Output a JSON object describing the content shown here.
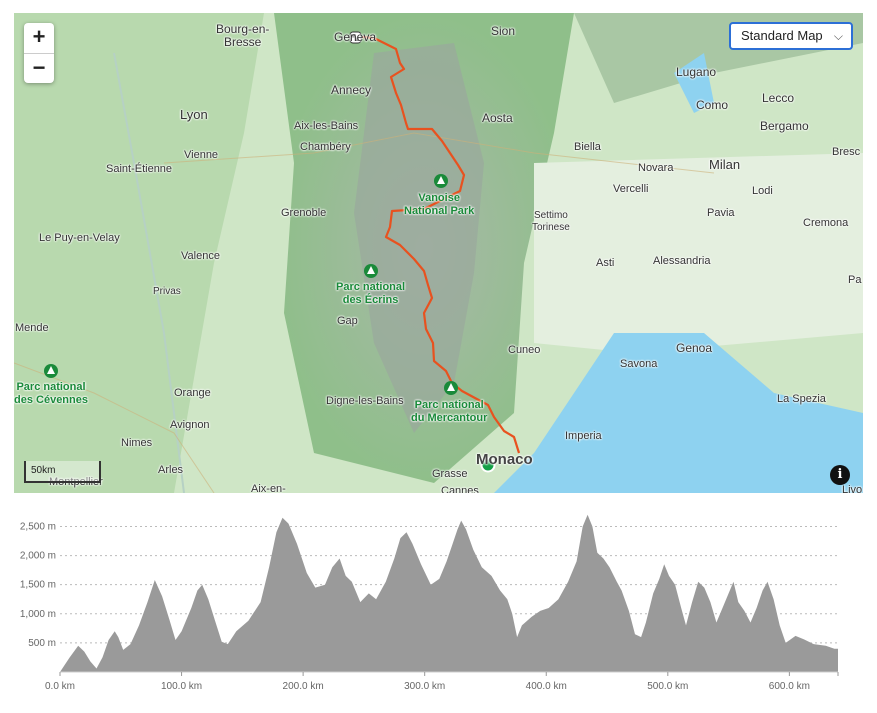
{
  "map": {
    "zoom_in": "+",
    "zoom_out": "−",
    "map_type": "Standard Map",
    "scale_label": "50km",
    "info_label": "i",
    "cities": [
      {
        "name": "Bourg-en-\nBresse"
      },
      {
        "name": "Geneva"
      },
      {
        "name": "Sion"
      },
      {
        "name": "Lugano"
      },
      {
        "name": "Annecy"
      },
      {
        "name": "Como"
      },
      {
        "name": "Lecco"
      },
      {
        "name": "Lyon"
      },
      {
        "name": "Aosta"
      },
      {
        "name": "Bergamo"
      },
      {
        "name": "Aix-les-Bains"
      },
      {
        "name": "Vienne"
      },
      {
        "name": "Chambéry"
      },
      {
        "name": "Biella"
      },
      {
        "name": "Milan"
      },
      {
        "name": "Bresc"
      },
      {
        "name": "Saint-Étienne"
      },
      {
        "name": "Novara"
      },
      {
        "name": "Vercelli"
      },
      {
        "name": "Lodi"
      },
      {
        "name": "Grenoble"
      },
      {
        "name": "Pavia"
      },
      {
        "name": "Settimo\nTorinese"
      },
      {
        "name": "Cremona"
      },
      {
        "name": "Le Puy-en-Velay"
      },
      {
        "name": "Valence"
      },
      {
        "name": "Asti"
      },
      {
        "name": "Alessandria"
      },
      {
        "name": "Privas"
      },
      {
        "name": "Pa"
      },
      {
        "name": "Gap"
      },
      {
        "name": "Mende"
      },
      {
        "name": "Cuneo"
      },
      {
        "name": "Genoa"
      },
      {
        "name": "Savona"
      },
      {
        "name": "Orange"
      },
      {
        "name": "Digne-les-Bains"
      },
      {
        "name": "La Spezia"
      },
      {
        "name": "Avignon"
      },
      {
        "name": "Imperia"
      },
      {
        "name": "Nimes"
      },
      {
        "name": "Monaco"
      },
      {
        "name": "Arles"
      },
      {
        "name": "Grasse"
      },
      {
        "name": "Montpellier"
      },
      {
        "name": "Aix-en-"
      },
      {
        "name": "Cannes"
      },
      {
        "name": "Livo"
      }
    ],
    "parks": [
      {
        "name": "Vanoise\nNational Park"
      },
      {
        "name": "Parc national\ndes Écrins"
      },
      {
        "name": "Parc national\ndes Cévennes"
      },
      {
        "name": "Parc national\ndu Mercantour"
      }
    ]
  },
  "elevation": {
    "y_labels": [
      "2,500 m",
      "2,000 m",
      "1,500 m",
      "1,000 m",
      "500 m"
    ],
    "x_labels": [
      "0.0 km",
      "100.0 km",
      "200.0 km",
      "300.0 km",
      "400.0 km",
      "500.0 km",
      "600.0 km"
    ],
    "profile_color": "#9a9a9a",
    "route_color": "#e8521f",
    "x_max_km": 640,
    "y_max_m": 2800,
    "profile": [
      [
        0,
        0
      ],
      [
        8,
        250
      ],
      [
        15,
        450
      ],
      [
        20,
        350
      ],
      [
        25,
        180
      ],
      [
        30,
        60
      ],
      [
        35,
        250
      ],
      [
        40,
        550
      ],
      [
        45,
        700
      ],
      [
        48,
        600
      ],
      [
        52,
        380
      ],
      [
        58,
        480
      ],
      [
        65,
        800
      ],
      [
        72,
        1200
      ],
      [
        78,
        1580
      ],
      [
        84,
        1300
      ],
      [
        90,
        900
      ],
      [
        95,
        550
      ],
      [
        100,
        700
      ],
      [
        108,
        1100
      ],
      [
        113,
        1400
      ],
      [
        117,
        1500
      ],
      [
        122,
        1250
      ],
      [
        128,
        850
      ],
      [
        133,
        520
      ],
      [
        138,
        480
      ],
      [
        145,
        700
      ],
      [
        155,
        880
      ],
      [
        165,
        1200
      ],
      [
        172,
        1800
      ],
      [
        178,
        2400
      ],
      [
        183,
        2650
      ],
      [
        188,
        2550
      ],
      [
        195,
        2200
      ],
      [
        203,
        1700
      ],
      [
        210,
        1450
      ],
      [
        218,
        1500
      ],
      [
        224,
        1800
      ],
      [
        230,
        1950
      ],
      [
        235,
        1650
      ],
      [
        240,
        1550
      ],
      [
        247,
        1200
      ],
      [
        254,
        1350
      ],
      [
        260,
        1250
      ],
      [
        268,
        1550
      ],
      [
        275,
        1950
      ],
      [
        280,
        2300
      ],
      [
        285,
        2400
      ],
      [
        290,
        2200
      ],
      [
        297,
        1850
      ],
      [
        305,
        1500
      ],
      [
        312,
        1600
      ],
      [
        318,
        1900
      ],
      [
        323,
        2200
      ],
      [
        327,
        2450
      ],
      [
        330,
        2600
      ],
      [
        334,
        2450
      ],
      [
        340,
        2100
      ],
      [
        347,
        1800
      ],
      [
        355,
        1650
      ],
      [
        362,
        1400
      ],
      [
        368,
        1250
      ],
      [
        372,
        1000
      ],
      [
        376,
        600
      ],
      [
        380,
        800
      ],
      [
        388,
        950
      ],
      [
        395,
        1050
      ],
      [
        402,
        1100
      ],
      [
        410,
        1250
      ],
      [
        418,
        1550
      ],
      [
        425,
        1900
      ],
      [
        430,
        2500
      ],
      [
        434,
        2700
      ],
      [
        438,
        2500
      ],
      [
        442,
        2050
      ],
      [
        447,
        1950
      ],
      [
        452,
        1800
      ],
      [
        458,
        1550
      ],
      [
        462,
        1400
      ],
      [
        468,
        1050
      ],
      [
        473,
        650
      ],
      [
        478,
        600
      ],
      [
        482,
        850
      ],
      [
        488,
        1350
      ],
      [
        493,
        1600
      ],
      [
        497,
        1850
      ],
      [
        501,
        1650
      ],
      [
        506,
        1500
      ],
      [
        511,
        1100
      ],
      [
        515,
        800
      ],
      [
        520,
        1200
      ],
      [
        525,
        1550
      ],
      [
        530,
        1450
      ],
      [
        535,
        1200
      ],
      [
        540,
        850
      ],
      [
        545,
        1100
      ],
      [
        550,
        1350
      ],
      [
        554,
        1550
      ],
      [
        558,
        1200
      ],
      [
        563,
        1050
      ],
      [
        568,
        850
      ],
      [
        573,
        1100
      ],
      [
        578,
        1400
      ],
      [
        582,
        1550
      ],
      [
        587,
        1250
      ],
      [
        592,
        800
      ],
      [
        597,
        500
      ],
      [
        605,
        620
      ],
      [
        612,
        560
      ],
      [
        620,
        480
      ],
      [
        630,
        450
      ],
      [
        637,
        400
      ],
      [
        640,
        400
      ]
    ]
  }
}
